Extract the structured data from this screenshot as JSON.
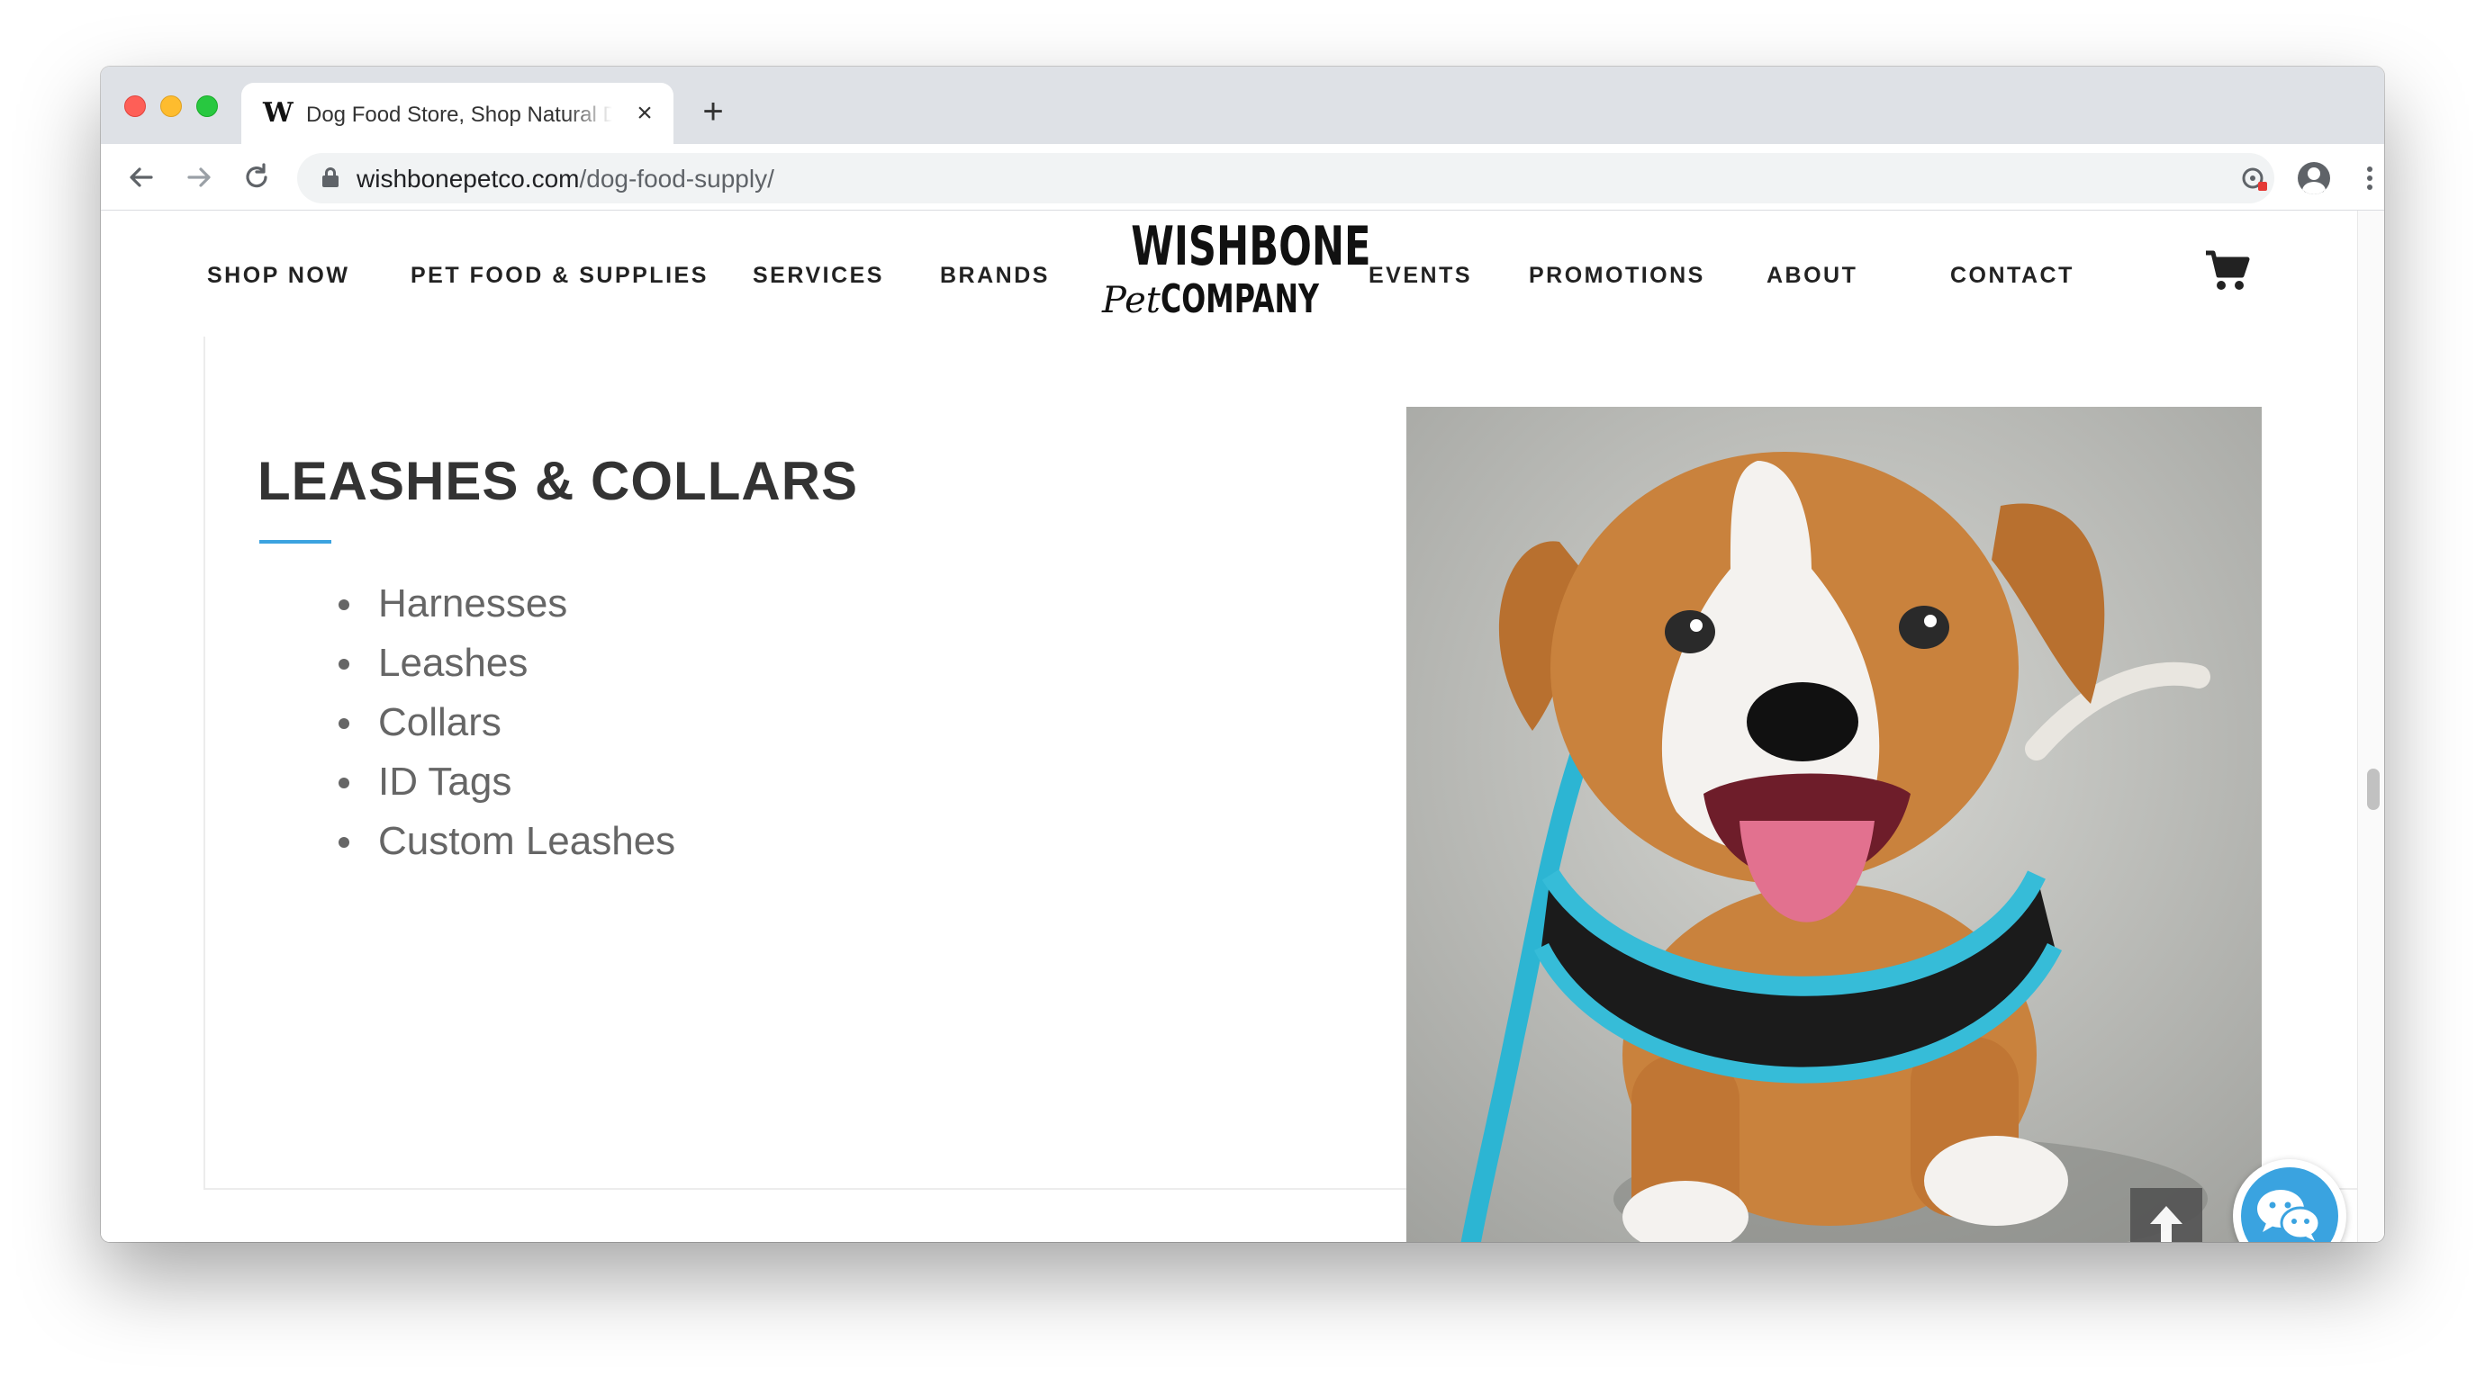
{
  "browser": {
    "tab": {
      "favicon": "W",
      "title": "Dog Food Store, Shop Natural Dog Food",
      "close_glyph": "×"
    },
    "new_tab_glyph": "+",
    "url_host": "wishbonepetco.com",
    "url_path": "/dog-food-supply/"
  },
  "site_nav": {
    "left_items": [
      "SHOP NOW",
      "PET FOOD & SUPPLIES",
      "SERVICES",
      "BRANDS"
    ],
    "right_items": [
      "EVENTS",
      "PROMOTIONS",
      "ABOUT",
      "CONTACT"
    ],
    "logo": {
      "top": "WISHBONE",
      "pet": "Pet",
      "company": "COMPANY"
    }
  },
  "section": {
    "title": "LEASHES & COLLARS",
    "items": [
      "Harnesses",
      "Leashes",
      "Collars",
      "ID Tags",
      "Custom Leashes"
    ]
  },
  "colors": {
    "accent": "#3ba3e0",
    "title_text": "#333333",
    "list_text": "#666666",
    "nav_text": "#222222"
  },
  "icons": [
    "lock-icon",
    "back-icon",
    "forward-icon",
    "reload-icon",
    "extension-icon",
    "star-icon",
    "profile-icon",
    "menu-icon",
    "cart-icon",
    "arrow-up-icon",
    "wechat-icon"
  ]
}
